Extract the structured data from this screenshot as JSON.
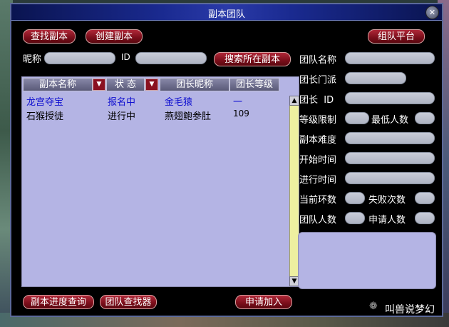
{
  "window": {
    "title": "副本团队"
  },
  "toolbar": {
    "find_label": "查找副本",
    "create_label": "创建副本",
    "platform_label": "组队平台"
  },
  "search": {
    "nickname_label": "昵称",
    "id_label": "ID",
    "search_label": "搜索所在副本"
  },
  "table": {
    "headers": {
      "name": "副本名称",
      "status": "状 态",
      "leader": "团长昵称",
      "level": "团长等级"
    },
    "rows": [
      {
        "name": "龙宫夺宝",
        "status": "报名中",
        "leader": "金毛猿",
        "level": "一"
      },
      {
        "name": "石猴授徒",
        "status": "进行中",
        "leader": "燕翅鲍参肚",
        "level": "109"
      }
    ]
  },
  "details": {
    "team_name": "团队名称",
    "leader_school": "团长门派",
    "leader_id": "团长  ID",
    "level_limit": "等级限制",
    "min_people": "最低人数",
    "difficulty": "副本难度",
    "start_time": "开始时间",
    "elapsed_time": "进行时间",
    "current_round": "当前环数",
    "fail_count": "失败次数",
    "team_size": "团队人数",
    "apply_count": "申请人数"
  },
  "bottom": {
    "progress_label": "副本进度查询",
    "team_finder_label": "团队查找器",
    "apply_label": "申请加入"
  },
  "watermark": {
    "text": "叫兽说梦幻"
  },
  "colors": {
    "row_highlight_text": "#1010d0",
    "row_text": "#000000",
    "button_red": "#8a1020"
  }
}
